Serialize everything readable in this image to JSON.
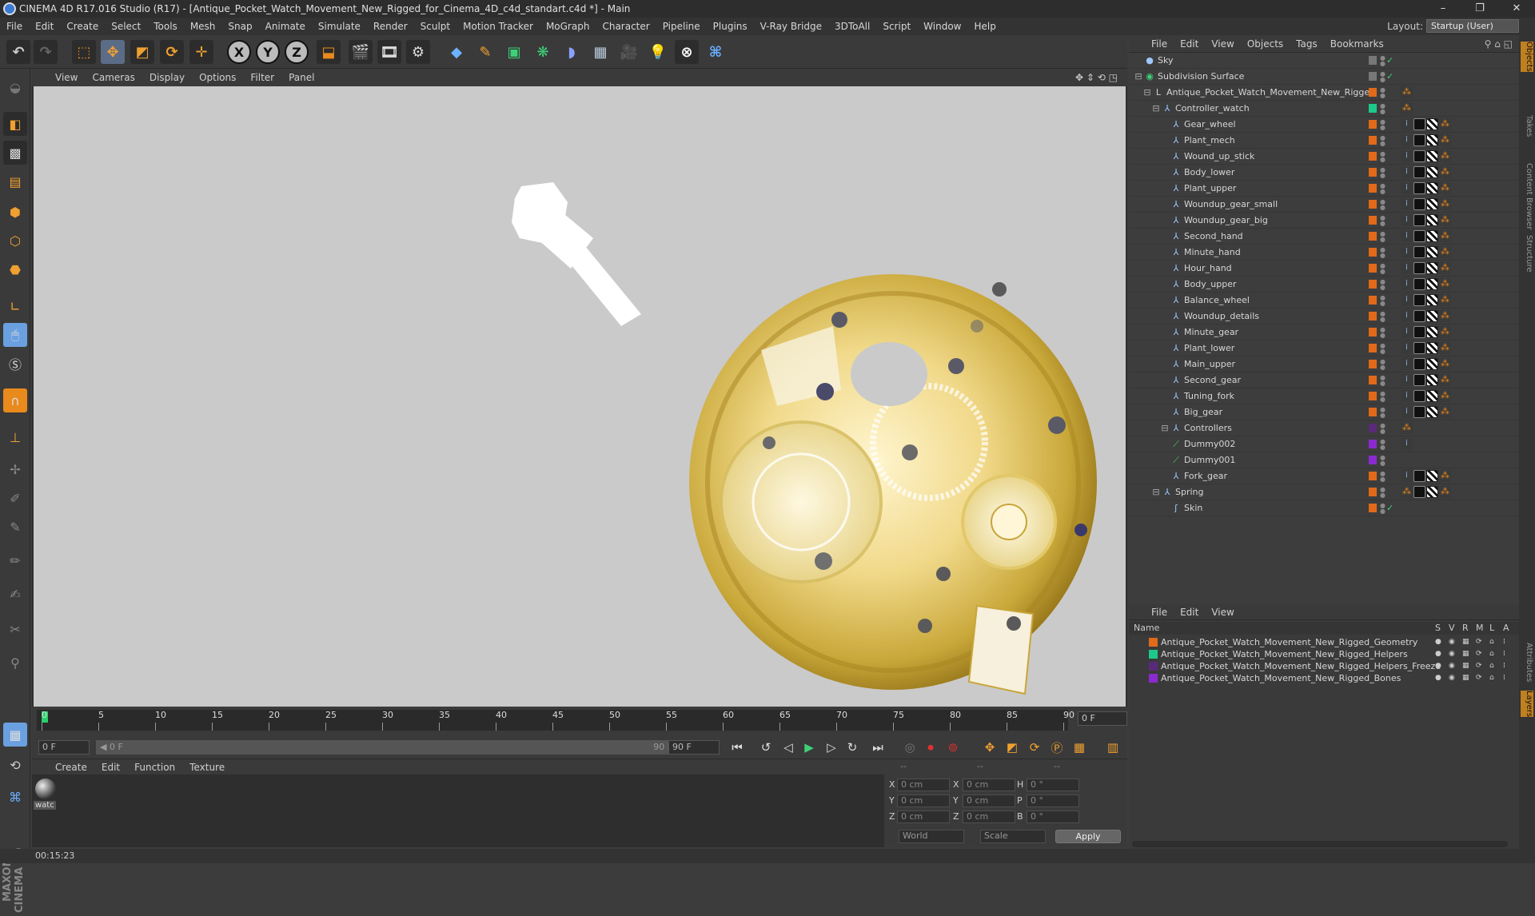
{
  "window": {
    "title": "CINEMA 4D R17.016 Studio (R17) - [Antique_Pocket_Watch_Movement_New_Rigged_for_Cinema_4D_c4d_standart.c4d *] - Main",
    "controls": {
      "minimize": "–",
      "maximize": "❐",
      "close": "✕"
    }
  },
  "menubar": {
    "items": [
      "File",
      "Edit",
      "Create",
      "Select",
      "Tools",
      "Mesh",
      "Snap",
      "Animate",
      "Simulate",
      "Render",
      "Sculpt",
      "Motion Tracker",
      "MoGraph",
      "Character",
      "Pipeline",
      "Plugins",
      "V-Ray Bridge",
      "3DToAll",
      "Script",
      "Window",
      "Help"
    ],
    "layout_label": "Layout:",
    "layout_value": "Startup (User)"
  },
  "toolbar": {
    "axis": [
      "X",
      "Y",
      "Z"
    ]
  },
  "viewport": {
    "menu": [
      "View",
      "Cameras",
      "Display",
      "Options",
      "Filter",
      "Panel"
    ]
  },
  "timeline": {
    "ticks": [
      "0",
      "5",
      "10",
      "15",
      "20",
      "25",
      "30",
      "35",
      "40",
      "45",
      "50",
      "55",
      "60",
      "65",
      "70",
      "75",
      "80",
      "85",
      "90"
    ],
    "current_frame": "0 F",
    "start_field": "0 F",
    "range_start": "◀ 0 F",
    "range_end": "90 F ▶",
    "end_field": "90 F"
  },
  "material_manager": {
    "menu": [
      "Create",
      "Edit",
      "Function",
      "Texture"
    ],
    "material_name": "watc"
  },
  "coordinates": {
    "header_dashes": [
      "--",
      "--",
      "--"
    ],
    "rows": [
      {
        "l1": "X",
        "v1": "0 cm",
        "l2": "X",
        "v2": "0 cm",
        "l3": "H",
        "v3": "0 °"
      },
      {
        "l1": "Y",
        "v1": "0 cm",
        "l2": "Y",
        "v2": "0 cm",
        "l3": "P",
        "v3": "0 °"
      },
      {
        "l1": "Z",
        "v1": "0 cm",
        "l2": "Z",
        "v2": "0 cm",
        "l3": "B",
        "v3": "0 °"
      }
    ],
    "mode_world": "World",
    "mode_scale": "Scale",
    "apply_label": "Apply"
  },
  "status": {
    "time": "00:15:23"
  },
  "object_manager": {
    "menu": [
      "File",
      "Edit",
      "View",
      "Objects",
      "Tags",
      "Bookmarks"
    ],
    "objects": [
      {
        "name": "Sky",
        "indent": 0,
        "color": "#777777",
        "icon": "sky-icon"
      },
      {
        "name": "Subdivision Surface",
        "indent": 0,
        "color": "#777777",
        "icon": "subdivision-icon"
      },
      {
        "name": "Antique_Pocket_Watch_Movement_New_Rigged",
        "indent": 1,
        "color": "#e06a1a",
        "icon": "null-icon"
      },
      {
        "name": "Controller_watch",
        "indent": 2,
        "color": "#1ec88a",
        "icon": "joint-icon"
      },
      {
        "name": "Gear_wheel",
        "indent": 3,
        "color": "#e06a1a",
        "icon": "joint-icon"
      },
      {
        "name": "Plant_mech",
        "indent": 3,
        "color": "#e06a1a",
        "icon": "joint-icon"
      },
      {
        "name": "Wound_up_stick",
        "indent": 3,
        "color": "#e06a1a",
        "icon": "joint-icon"
      },
      {
        "name": "Body_lower",
        "indent": 3,
        "color": "#e06a1a",
        "icon": "joint-icon"
      },
      {
        "name": "Plant_upper",
        "indent": 3,
        "color": "#e06a1a",
        "icon": "joint-icon"
      },
      {
        "name": "Woundup_gear_small",
        "indent": 3,
        "color": "#e06a1a",
        "icon": "joint-icon"
      },
      {
        "name": "Woundup_gear_big",
        "indent": 3,
        "color": "#e06a1a",
        "icon": "joint-icon"
      },
      {
        "name": "Second_hand",
        "indent": 3,
        "color": "#e06a1a",
        "icon": "joint-icon"
      },
      {
        "name": "Minute_hand",
        "indent": 3,
        "color": "#e06a1a",
        "icon": "joint-icon"
      },
      {
        "name": "Hour_hand",
        "indent": 3,
        "color": "#e06a1a",
        "icon": "joint-icon"
      },
      {
        "name": "Body_upper",
        "indent": 3,
        "color": "#e06a1a",
        "icon": "joint-icon"
      },
      {
        "name": "Balance_wheel",
        "indent": 3,
        "color": "#e06a1a",
        "icon": "joint-icon"
      },
      {
        "name": "Woundup_details",
        "indent": 3,
        "color": "#e06a1a",
        "icon": "joint-icon"
      },
      {
        "name": "Minute_gear",
        "indent": 3,
        "color": "#e06a1a",
        "icon": "joint-icon"
      },
      {
        "name": "Plant_lower",
        "indent": 3,
        "color": "#e06a1a",
        "icon": "joint-icon"
      },
      {
        "name": "Main_upper",
        "indent": 3,
        "color": "#e06a1a",
        "icon": "joint-icon"
      },
      {
        "name": "Second_gear",
        "indent": 3,
        "color": "#e06a1a",
        "icon": "joint-icon"
      },
      {
        "name": "Tuning_fork",
        "indent": 3,
        "color": "#e06a1a",
        "icon": "joint-icon"
      },
      {
        "name": "Big_gear",
        "indent": 3,
        "color": "#e06a1a",
        "icon": "joint-icon"
      },
      {
        "name": "Controllers",
        "indent": 3,
        "color": "#5a2a7a",
        "icon": "joint-icon"
      },
      {
        "name": "Dummy002",
        "indent": 3,
        "color": "#8a2ad0",
        "icon": "bone-icon"
      },
      {
        "name": "Dummy001",
        "indent": 3,
        "color": "#8a2ad0",
        "icon": "bone-icon"
      },
      {
        "name": "Fork_gear",
        "indent": 3,
        "color": "#e06a1a",
        "icon": "joint-icon"
      },
      {
        "name": "Spring",
        "indent": 2,
        "color": "#e06a1a",
        "icon": "joint-icon"
      },
      {
        "name": "Skin",
        "indent": 3,
        "color": "#e06a1a",
        "icon": "skin-icon"
      }
    ]
  },
  "layer_manager": {
    "menu": [
      "File",
      "Edit",
      "View"
    ],
    "columns": {
      "name": "Name",
      "s": "S",
      "v": "V",
      "r": "R",
      "m": "M",
      "l": "L",
      "a": "A"
    },
    "layers": [
      {
        "name": "Antique_Pocket_Watch_Movement_New_Rigged_Geometry",
        "color": "#e06a1a"
      },
      {
        "name": "Antique_Pocket_Watch_Movement_New_Rigged_Helpers",
        "color": "#1ec88a"
      },
      {
        "name": "Antique_Pocket_Watch_Movement_New_Rigged_Helpers_Freeze",
        "color": "#5a2a7a"
      },
      {
        "name": "Antique_Pocket_Watch_Movement_New_Rigged_Bones",
        "color": "#8a2ad0"
      }
    ]
  },
  "right_tabs": [
    "Objects",
    "Takes",
    "Content Browser",
    "Structure",
    "Attributes",
    "Layers"
  ]
}
